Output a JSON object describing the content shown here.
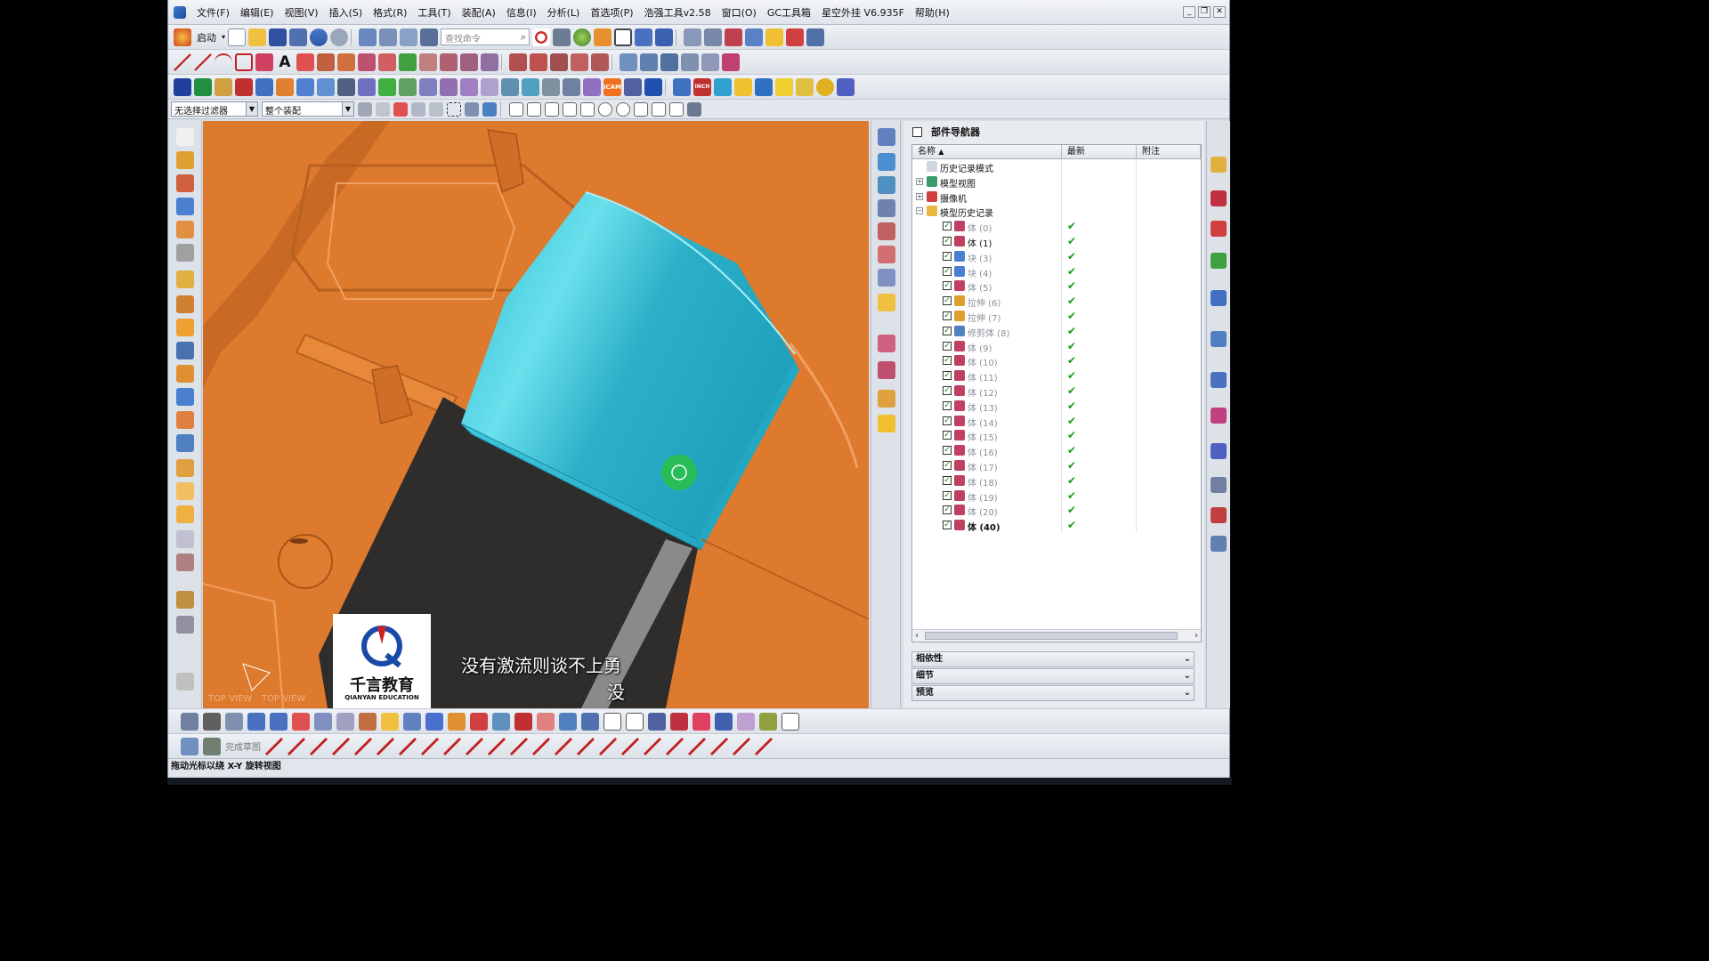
{
  "menu": [
    "文件(F)",
    "编辑(E)",
    "视图(V)",
    "插入(S)",
    "格式(R)",
    "工具(T)",
    "装配(A)",
    "信息(I)",
    "分析(L)",
    "首选项(P)",
    "浩强工具v2.58",
    "窗口(O)",
    "GC工具箱",
    "星空外挂 V6.935F",
    "帮助(H)"
  ],
  "toolbar": {
    "start_label": "启动",
    "search_placeholder": "查找命令"
  },
  "filter": {
    "selection_filter": "无选择过滤器",
    "assembly_scope": "整个装配"
  },
  "navigator": {
    "title": "部件导航器",
    "columns": {
      "name": "名称",
      "latest": "最新",
      "note": "附注"
    },
    "rows": [
      {
        "label": "历史记录模式",
        "level": 1,
        "icon": "clock-icon",
        "expander": "",
        "checkbox": false,
        "latest": "",
        "style": "normal"
      },
      {
        "label": "模型视图",
        "level": 1,
        "icon": "model-views-icon",
        "expander": "+",
        "checkbox": false,
        "latest": "",
        "style": "normal"
      },
      {
        "label": "摄像机",
        "level": 1,
        "icon": "camera-icon",
        "expander": "+",
        "checkbox": false,
        "latest": "",
        "style": "normal"
      },
      {
        "label": "模型历史记录",
        "level": 1,
        "icon": "folder-icon",
        "expander": "−",
        "checkbox": false,
        "latest": "",
        "style": "normal"
      },
      {
        "label": "体 (0)",
        "level": 2,
        "icon": "body-icon",
        "checkbox": true,
        "latest": "✔",
        "style": "dim"
      },
      {
        "label": "体 (1)",
        "level": 2,
        "icon": "body-icon",
        "checkbox": true,
        "latest": "✔",
        "style": "normal"
      },
      {
        "label": "块 (3)",
        "level": 2,
        "icon": "block-icon",
        "checkbox": true,
        "latest": "✔",
        "style": "dim"
      },
      {
        "label": "块 (4)",
        "level": 2,
        "icon": "block-icon",
        "checkbox": true,
        "latest": "✔",
        "style": "dim"
      },
      {
        "label": "体 (5)",
        "level": 2,
        "icon": "body-icon",
        "checkbox": true,
        "latest": "✔",
        "style": "dim"
      },
      {
        "label": "拉伸 (6)",
        "level": 2,
        "icon": "extrude-icon",
        "checkbox": true,
        "latest": "✔",
        "style": "dim"
      },
      {
        "label": "拉伸 (7)",
        "level": 2,
        "icon": "extrude-icon",
        "checkbox": true,
        "latest": "✔",
        "style": "dim"
      },
      {
        "label": "修剪体 (8)",
        "level": 2,
        "icon": "trim-body-icon",
        "checkbox": true,
        "latest": "✔",
        "style": "dim"
      },
      {
        "label": "体 (9)",
        "level": 2,
        "icon": "body-icon",
        "checkbox": true,
        "latest": "✔",
        "style": "dim"
      },
      {
        "label": "体 (10)",
        "level": 2,
        "icon": "body-icon",
        "checkbox": true,
        "latest": "✔",
        "style": "dim"
      },
      {
        "label": "体 (11)",
        "level": 2,
        "icon": "body-icon",
        "checkbox": true,
        "latest": "✔",
        "style": "dim"
      },
      {
        "label": "体 (12)",
        "level": 2,
        "icon": "body-icon",
        "checkbox": true,
        "latest": "✔",
        "style": "dim"
      },
      {
        "label": "体 (13)",
        "level": 2,
        "icon": "body-icon",
        "checkbox": true,
        "latest": "✔",
        "style": "dim"
      },
      {
        "label": "体 (14)",
        "level": 2,
        "icon": "body-icon",
        "checkbox": true,
        "latest": "✔",
        "style": "dim"
      },
      {
        "label": "体 (15)",
        "level": 2,
        "icon": "body-icon",
        "checkbox": true,
        "latest": "✔",
        "style": "dim"
      },
      {
        "label": "体 (16)",
        "level": 2,
        "icon": "body-icon",
        "checkbox": true,
        "latest": "✔",
        "style": "dim"
      },
      {
        "label": "体 (17)",
        "level": 2,
        "icon": "body-icon",
        "checkbox": true,
        "latest": "✔",
        "style": "dim"
      },
      {
        "label": "体 (18)",
        "level": 2,
        "icon": "body-icon",
        "checkbox": true,
        "latest": "✔",
        "style": "dim"
      },
      {
        "label": "体 (19)",
        "level": 2,
        "icon": "body-icon",
        "checkbox": true,
        "latest": "✔",
        "style": "dim"
      },
      {
        "label": "体 (20)",
        "level": 2,
        "icon": "body-icon",
        "checkbox": true,
        "latest": "✔",
        "style": "dim"
      },
      {
        "label": "体 (40)",
        "level": 2,
        "icon": "body-icon",
        "checkbox": true,
        "latest": "✔",
        "style": "bold"
      }
    ],
    "sections": [
      "相依性",
      "细节",
      "预览"
    ]
  },
  "bottom_toolbar": {
    "finish_sketch_label": "完成草图"
  },
  "status_text": "拖动光标以绕 X-Y 旋转视图",
  "viewport": {
    "view_labels": [
      "TOP VIEW",
      "TOP VIEW"
    ],
    "subtitle_line1": "没有激流则谈不上勇",
    "subtitle_line2": "没",
    "logo_name": "千言教育",
    "logo_sub": "QIANYAN EDUCATION"
  },
  "colors": {
    "part_orange": "#de7a2e",
    "highlight_cyan": "#30c8dc",
    "dark_face": "#2e2e2e",
    "check_green": "#1a9a1a"
  }
}
